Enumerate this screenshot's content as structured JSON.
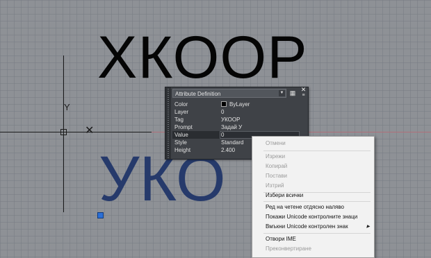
{
  "canvas": {
    "big_text": "ХКООР",
    "blue_text": "УКО",
    "y_axis_label": "Y",
    "x_axis_marker": "✕"
  },
  "palette": {
    "title": "Attribute Definition",
    "properties": [
      {
        "key": "Color",
        "value": "ByLayer"
      },
      {
        "key": "Layer",
        "value": "0"
      },
      {
        "key": "Tag",
        "value": "УКООР"
      },
      {
        "key": "Prompt",
        "value": "Задай У"
      },
      {
        "key": "Value",
        "value": "0"
      },
      {
        "key": "Style",
        "value": "Standard"
      },
      {
        "key": "Height",
        "value": "2.400"
      }
    ]
  },
  "context_menu": {
    "items": [
      {
        "label": "Отмени",
        "enabled": false
      },
      {
        "label": "Изрежи",
        "enabled": false
      },
      {
        "label": "Копирай",
        "enabled": false
      },
      {
        "label": "Постави",
        "enabled": false
      },
      {
        "label": "Изтрий",
        "enabled": false
      },
      {
        "label": "Избери всички",
        "enabled": true
      },
      {
        "label": "Ред на четене отдясно наляво",
        "enabled": true
      },
      {
        "label": "Покажи Unicode контролните знаци",
        "enabled": true
      },
      {
        "label": "Вмъкни Unicode контролен знак",
        "enabled": true,
        "submenu": true
      },
      {
        "label": "Отвори IME",
        "enabled": true
      },
      {
        "label": "Преконвертиране",
        "enabled": false
      }
    ]
  },
  "colors": {
    "canvas_bg": "#8e9196",
    "palette_bg": "#3f4247",
    "blue_text": "#263a6b",
    "grip": "#2b6fd6"
  }
}
